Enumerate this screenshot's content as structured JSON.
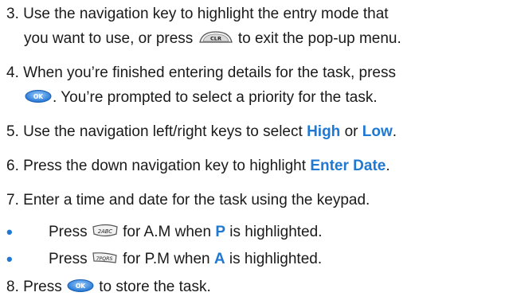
{
  "steps": [
    {
      "num": "3.",
      "line1_a": "Use the navigation key to highlight the entry mode that",
      "line2_a": "you want to use, or press",
      "line2_b": "to exit the pop-up menu."
    },
    {
      "num": "4.",
      "line1_a": "When you’re finished entering details for the task, press",
      "line2_b": ". You’re prompted to select a priority for the task."
    },
    {
      "num": "5.",
      "text_a": "Use the navigation left/right keys to select",
      "hl1": "High",
      "text_b": "or",
      "hl2": "Low",
      "text_c": "."
    },
    {
      "num": "6.",
      "text_a": "Press the down navigation key to highlight",
      "hl1": "Enter Date",
      "text_c": "."
    },
    {
      "num": "7.",
      "text_a": "Enter a time and date for the task using the keypad."
    },
    {
      "num": "8.",
      "text_a": "Press",
      "text_b": "to store the task."
    }
  ],
  "bullets": [
    {
      "text_a": "Press",
      "text_b": "for A.M when",
      "hl": "P",
      "text_c": "is highlighted."
    },
    {
      "text_a": "Press",
      "text_b": "for P.M when",
      "hl": "A",
      "text_c": "is highlighted."
    }
  ],
  "keys": {
    "clr": "CLR",
    "ok": "OK",
    "two": "2ABC",
    "seven": "7PQRS"
  },
  "bullet_glyph": "•"
}
